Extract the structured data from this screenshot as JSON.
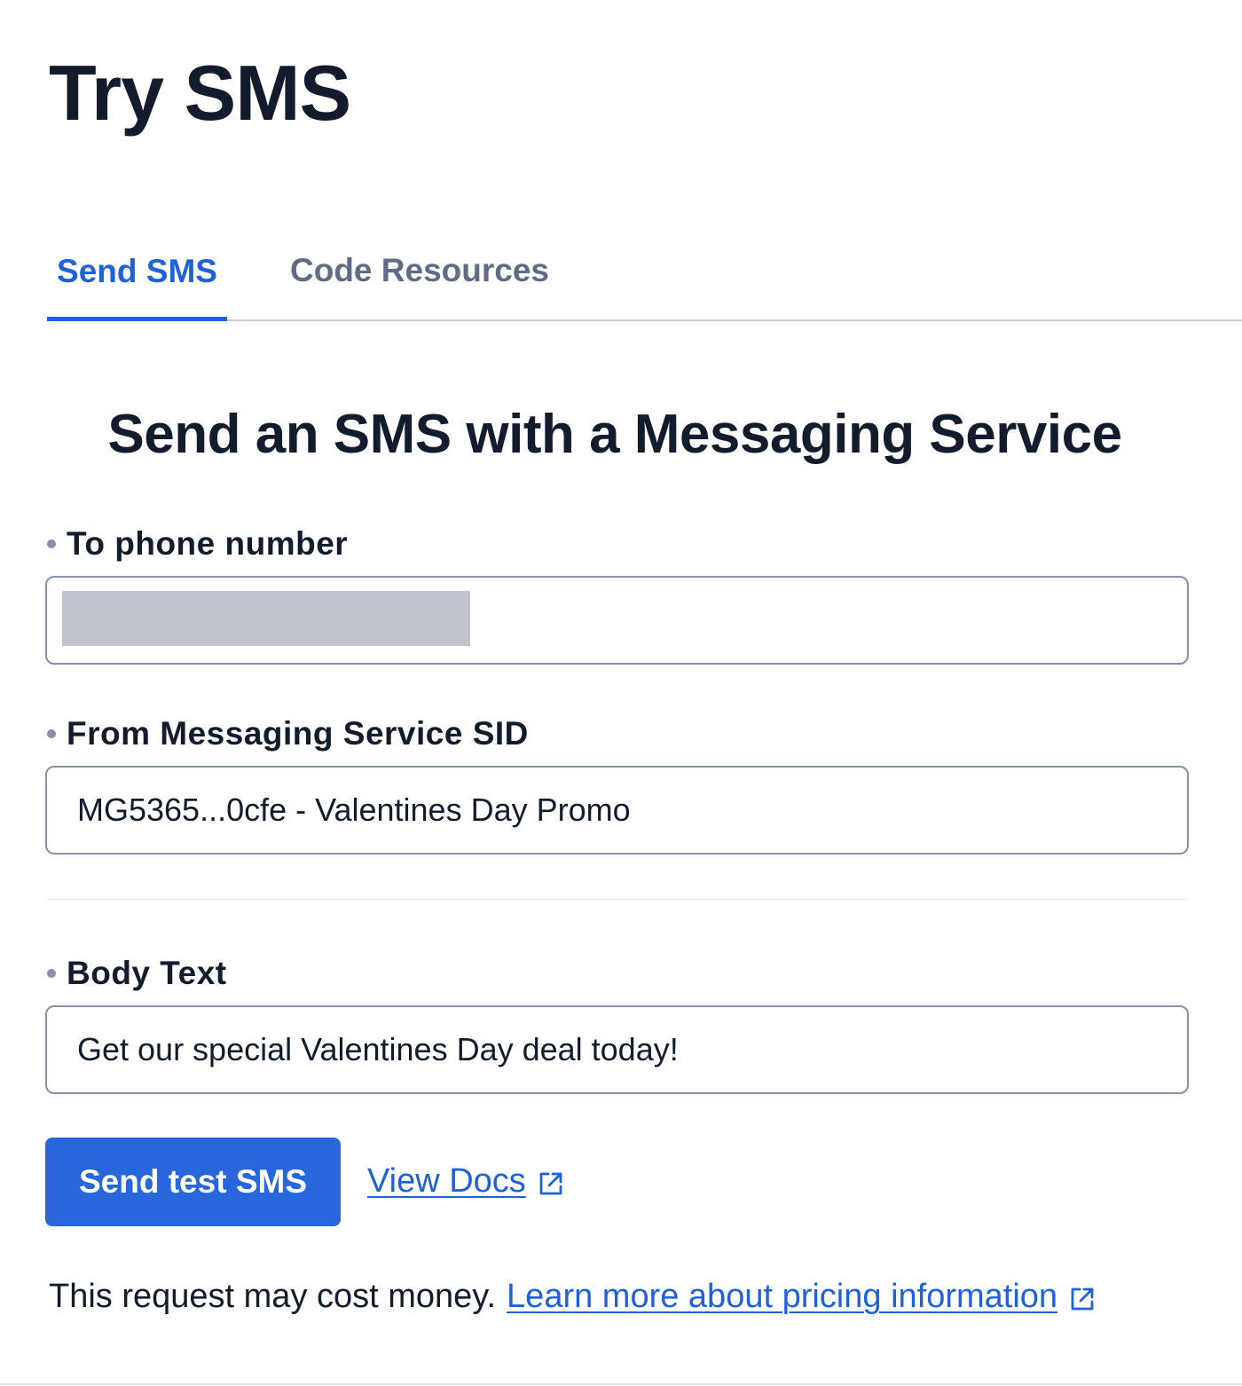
{
  "page": {
    "title": "Try SMS"
  },
  "tabs": [
    {
      "label": "Send SMS",
      "selected": true
    },
    {
      "label": "Code Resources",
      "selected": false
    }
  ],
  "form": {
    "heading": "Send an SMS with a Messaging Service",
    "to_phone": {
      "label": "To phone number",
      "value": "",
      "redacted": true
    },
    "from_service": {
      "label": "From Messaging Service SID",
      "value": "MG5365...0cfe - Valentines Day Promo"
    },
    "body_text": {
      "label": "Body Text",
      "value": "Get our special Valentines Day deal today!"
    },
    "submit_label": "Send test SMS",
    "docs_link": "View Docs"
  },
  "footer": {
    "note": "This request may cost money.",
    "pricing_link": "Learn more about pricing information"
  },
  "colors": {
    "accent": "#1f61d7",
    "button": "#2866dc",
    "text": "#121c2d",
    "muted_tab": "#606b85",
    "border": "#8891aa"
  },
  "icons": {
    "external_link": "external-link-icon",
    "required": "required-dot-icon"
  }
}
